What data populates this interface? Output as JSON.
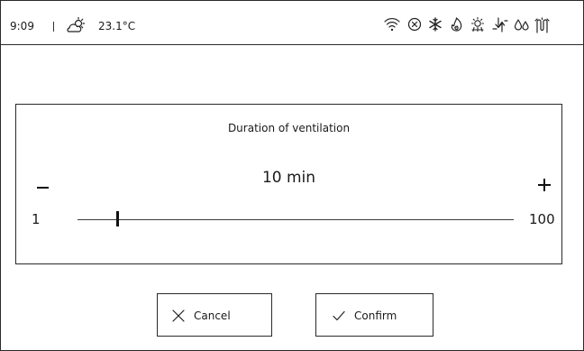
{
  "status_bar": {
    "time": "9:09",
    "weather_icon": "partly-sunny-icon",
    "temperature": "23.1°C",
    "icons": [
      "wifi-icon",
      "close-circle-icon",
      "snowflake-icon",
      "flame-icon",
      "sun-cloud-icon",
      "ventilation-arrows-icon",
      "drops-icon",
      "heating-coil-icon"
    ]
  },
  "ventilation": {
    "title": "Duration of ventilation",
    "value_text": "10 min",
    "value": 10,
    "unit": "min",
    "min_label": "1",
    "max_label": "100",
    "min": 1,
    "max": 100
  },
  "actions": {
    "cancel_label": "Cancel",
    "confirm_label": "Confirm"
  },
  "colors": {
    "background": "#ffffff",
    "line": "#2a2a2a",
    "text": "#1a1a1a"
  }
}
